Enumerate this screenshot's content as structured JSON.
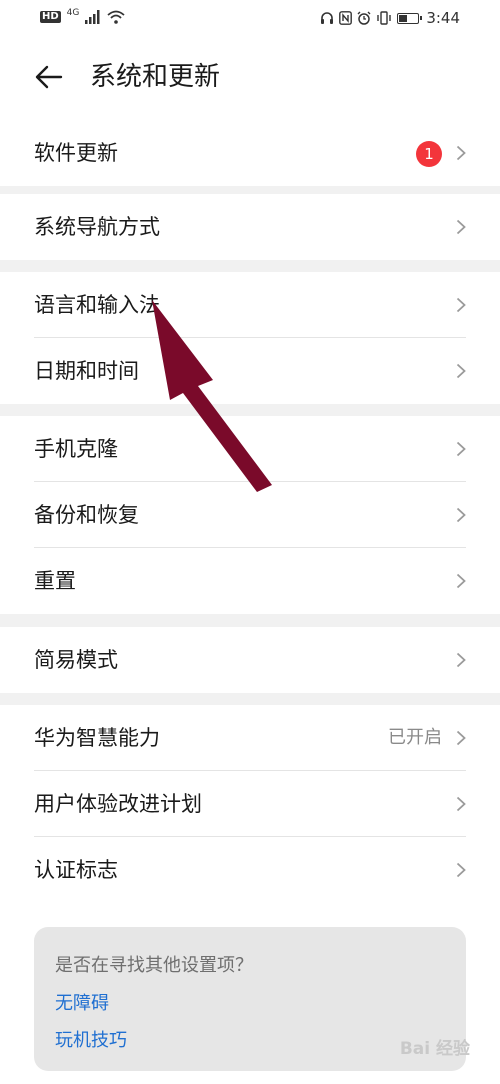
{
  "status_bar": {
    "hd_label": "HD",
    "network_label": "4G",
    "time": "3:44",
    "battery_level": 0.45
  },
  "header": {
    "title": "系统和更新"
  },
  "groups": [
    {
      "items": [
        {
          "label": "软件更新",
          "badge": "1"
        }
      ]
    },
    {
      "items": [
        {
          "label": "系统导航方式"
        }
      ]
    },
    {
      "items": [
        {
          "label": "语言和输入法"
        },
        {
          "label": "日期和时间"
        }
      ]
    },
    {
      "items": [
        {
          "label": "手机克隆"
        },
        {
          "label": "备份和恢复"
        },
        {
          "label": "重置"
        }
      ]
    },
    {
      "items": [
        {
          "label": "简易模式"
        }
      ]
    },
    {
      "items": [
        {
          "label": "华为智慧能力",
          "value": "已开启"
        },
        {
          "label": "用户体验改进计划"
        },
        {
          "label": "认证标志"
        }
      ]
    }
  ],
  "tips": {
    "question": "是否在寻找其他设置项？",
    "links": [
      "无障碍",
      "玩机技巧"
    ]
  },
  "watermark": "Bai 经验",
  "colors": {
    "badge": "#f3353b",
    "link": "#1f6fd1",
    "annotation_arrow": "#7a0a2a"
  }
}
